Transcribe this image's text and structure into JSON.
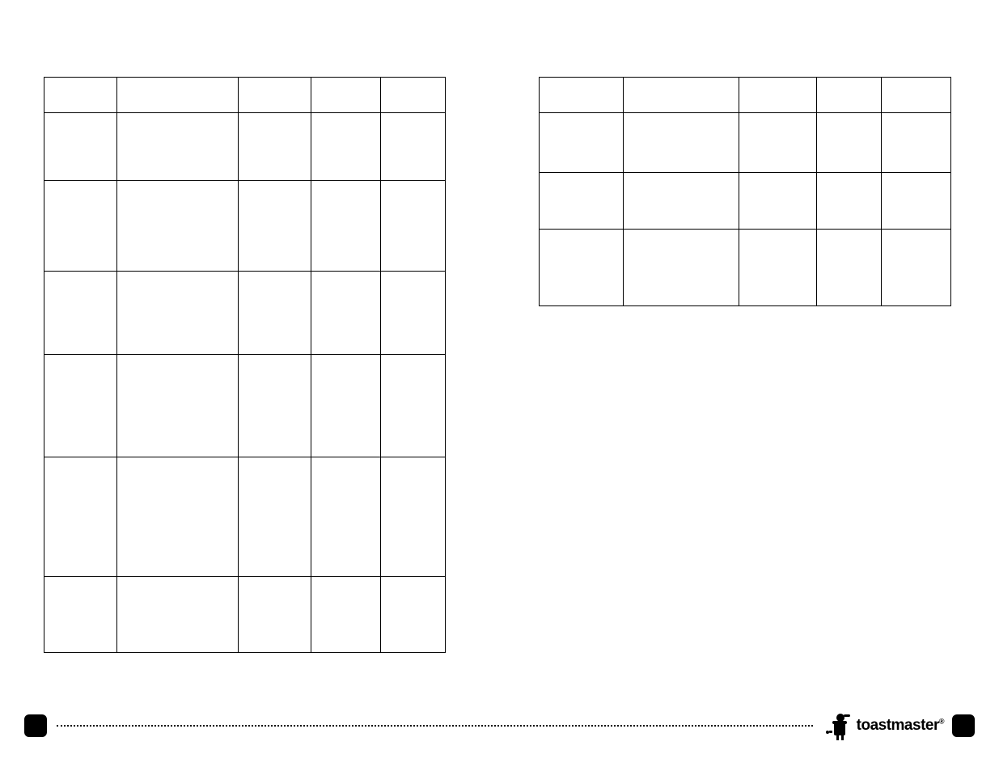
{
  "footer": {
    "logo_text": "toastmaster",
    "logo_symbol": "®"
  }
}
